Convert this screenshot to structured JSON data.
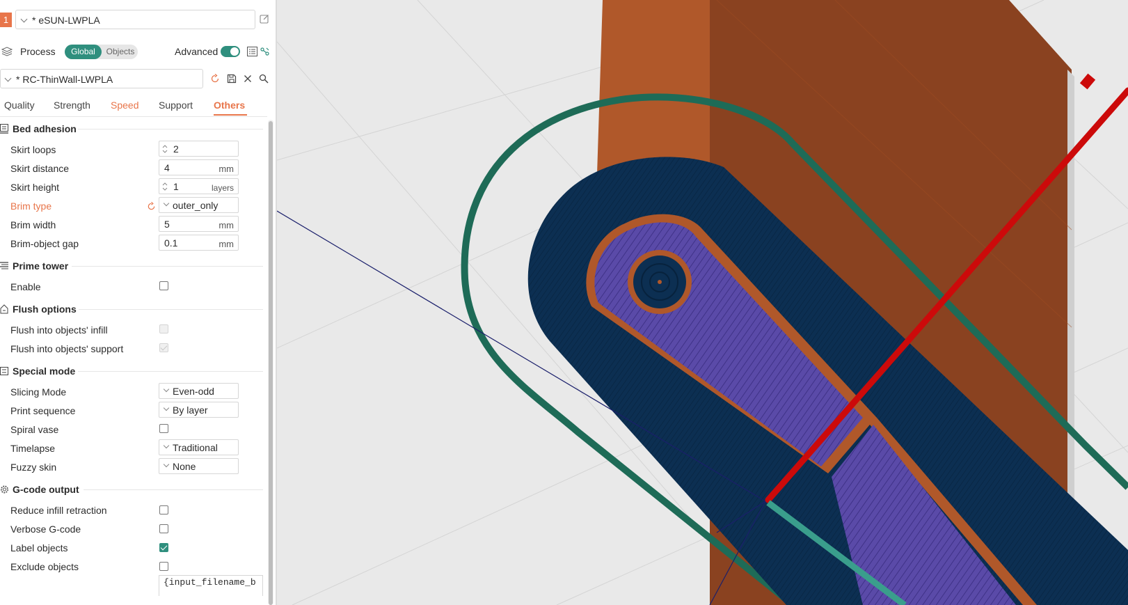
{
  "filament": {
    "index": "1",
    "name": "* eSUN-LWPLA",
    "color": "#e8754a"
  },
  "process": {
    "label": "Process",
    "seg_global": "Global",
    "seg_objects": "Objects",
    "advanced_label": "Advanced",
    "advanced_on": true
  },
  "preset": {
    "name": "* RC-ThinWall-LWPLA"
  },
  "tabs": [
    {
      "label": "Quality",
      "state": "normal"
    },
    {
      "label": "Strength",
      "state": "normal"
    },
    {
      "label": "Speed",
      "state": "modified"
    },
    {
      "label": "Support",
      "state": "normal"
    },
    {
      "label": "Others",
      "state": "active"
    }
  ],
  "sections": {
    "bed_adhesion": {
      "title": "Bed adhesion",
      "skirt_loops": {
        "label": "Skirt loops",
        "value": "2"
      },
      "skirt_distance": {
        "label": "Skirt distance",
        "value": "4",
        "unit": "mm"
      },
      "skirt_height": {
        "label": "Skirt height",
        "value": "1",
        "unit": "layers"
      },
      "brim_type": {
        "label": "Brim type",
        "value": "outer_only"
      },
      "brim_width": {
        "label": "Brim width",
        "value": "5",
        "unit": "mm"
      },
      "brim_gap": {
        "label": "Brim-object gap",
        "value": "0.1",
        "unit": "mm"
      }
    },
    "prime_tower": {
      "title": "Prime tower",
      "enable": {
        "label": "Enable",
        "checked": false
      }
    },
    "flush_options": {
      "title": "Flush options",
      "infill": {
        "label": "Flush into objects' infill",
        "checked": false
      },
      "support": {
        "label": "Flush into objects' support",
        "checked": true
      }
    },
    "special_mode": {
      "title": "Special mode",
      "slicing_mode": {
        "label": "Slicing Mode",
        "value": "Even-odd"
      },
      "print_sequence": {
        "label": "Print sequence",
        "value": "By layer"
      },
      "spiral_vase": {
        "label": "Spiral vase",
        "checked": false
      },
      "timelapse": {
        "label": "Timelapse",
        "value": "Traditional"
      },
      "fuzzy_skin": {
        "label": "Fuzzy skin",
        "value": "None"
      }
    },
    "gcode_output": {
      "title": "G-code output",
      "reduce_retraction": {
        "label": "Reduce infill retraction",
        "checked": false
      },
      "verbose": {
        "label": "Verbose G-code",
        "checked": false
      },
      "label_objects": {
        "label": "Label objects",
        "checked": true
      },
      "exclude_objects": {
        "label": "Exclude objects",
        "checked": false
      },
      "filename_format": "{input_filename_b"
    }
  },
  "colors": {
    "accent_teal": "#2f8f7e",
    "accent_orange": "#e8754a",
    "model_orange": "#8a4220",
    "brim_navy": "#0b2d4f",
    "infill_purple": "#5a4aa8",
    "skirt_green": "#1e6b57",
    "axis_red": "#cc0a0a"
  }
}
